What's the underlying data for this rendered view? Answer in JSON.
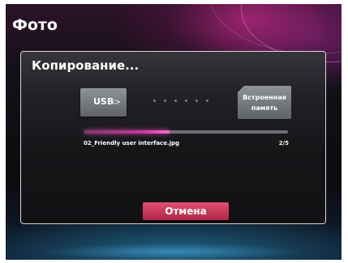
{
  "app": {
    "title": "Фото"
  },
  "dialog": {
    "title": "Копирование...",
    "source": {
      "label": "USB",
      "icon": "usb-icon"
    },
    "destination": {
      "label": "Встроенная\nпамять"
    },
    "progress": {
      "fraction": 0.42
    },
    "file": {
      "name": "02_Friendly user interface.jpg",
      "count": "2/5"
    },
    "cancel_label": "Отмена"
  },
  "colors": {
    "accent": "#c8399c",
    "cancel_button": "#c93455",
    "dialog_border": "#d8d8d8"
  }
}
